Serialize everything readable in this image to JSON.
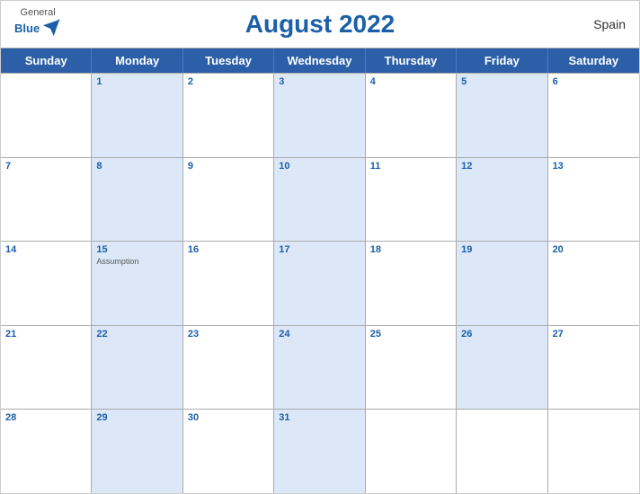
{
  "header": {
    "title": "August 2022",
    "country": "Spain",
    "logo": {
      "general": "General",
      "blue": "Blue"
    }
  },
  "dayHeaders": [
    "Sunday",
    "Monday",
    "Tuesday",
    "Wednesday",
    "Thursday",
    "Friday",
    "Saturday"
  ],
  "weeks": [
    [
      {
        "num": "",
        "holiday": "",
        "blue": false,
        "empty": true
      },
      {
        "num": "1",
        "holiday": "",
        "blue": true
      },
      {
        "num": "2",
        "holiday": "",
        "blue": false
      },
      {
        "num": "3",
        "holiday": "",
        "blue": true
      },
      {
        "num": "4",
        "holiday": "",
        "blue": false
      },
      {
        "num": "5",
        "holiday": "",
        "blue": true
      },
      {
        "num": "6",
        "holiday": "",
        "blue": false
      }
    ],
    [
      {
        "num": "7",
        "holiday": "",
        "blue": false
      },
      {
        "num": "8",
        "holiday": "",
        "blue": true
      },
      {
        "num": "9",
        "holiday": "",
        "blue": false
      },
      {
        "num": "10",
        "holiday": "",
        "blue": true
      },
      {
        "num": "11",
        "holiday": "",
        "blue": false
      },
      {
        "num": "12",
        "holiday": "",
        "blue": true
      },
      {
        "num": "13",
        "holiday": "",
        "blue": false
      }
    ],
    [
      {
        "num": "14",
        "holiday": "",
        "blue": false
      },
      {
        "num": "15",
        "holiday": "Assumption",
        "blue": true
      },
      {
        "num": "16",
        "holiday": "",
        "blue": false
      },
      {
        "num": "17",
        "holiday": "",
        "blue": true
      },
      {
        "num": "18",
        "holiday": "",
        "blue": false
      },
      {
        "num": "19",
        "holiday": "",
        "blue": true
      },
      {
        "num": "20",
        "holiday": "",
        "blue": false
      }
    ],
    [
      {
        "num": "21",
        "holiday": "",
        "blue": false
      },
      {
        "num": "22",
        "holiday": "",
        "blue": true
      },
      {
        "num": "23",
        "holiday": "",
        "blue": false
      },
      {
        "num": "24",
        "holiday": "",
        "blue": true
      },
      {
        "num": "25",
        "holiday": "",
        "blue": false
      },
      {
        "num": "26",
        "holiday": "",
        "blue": true
      },
      {
        "num": "27",
        "holiday": "",
        "blue": false
      }
    ],
    [
      {
        "num": "28",
        "holiday": "",
        "blue": false
      },
      {
        "num": "29",
        "holiday": "",
        "blue": true
      },
      {
        "num": "30",
        "holiday": "",
        "blue": false
      },
      {
        "num": "31",
        "holiday": "",
        "blue": true
      },
      {
        "num": "",
        "holiday": "",
        "blue": false,
        "empty": true
      },
      {
        "num": "",
        "holiday": "",
        "blue": false,
        "empty": true
      },
      {
        "num": "",
        "holiday": "",
        "blue": false,
        "empty": true
      }
    ]
  ]
}
